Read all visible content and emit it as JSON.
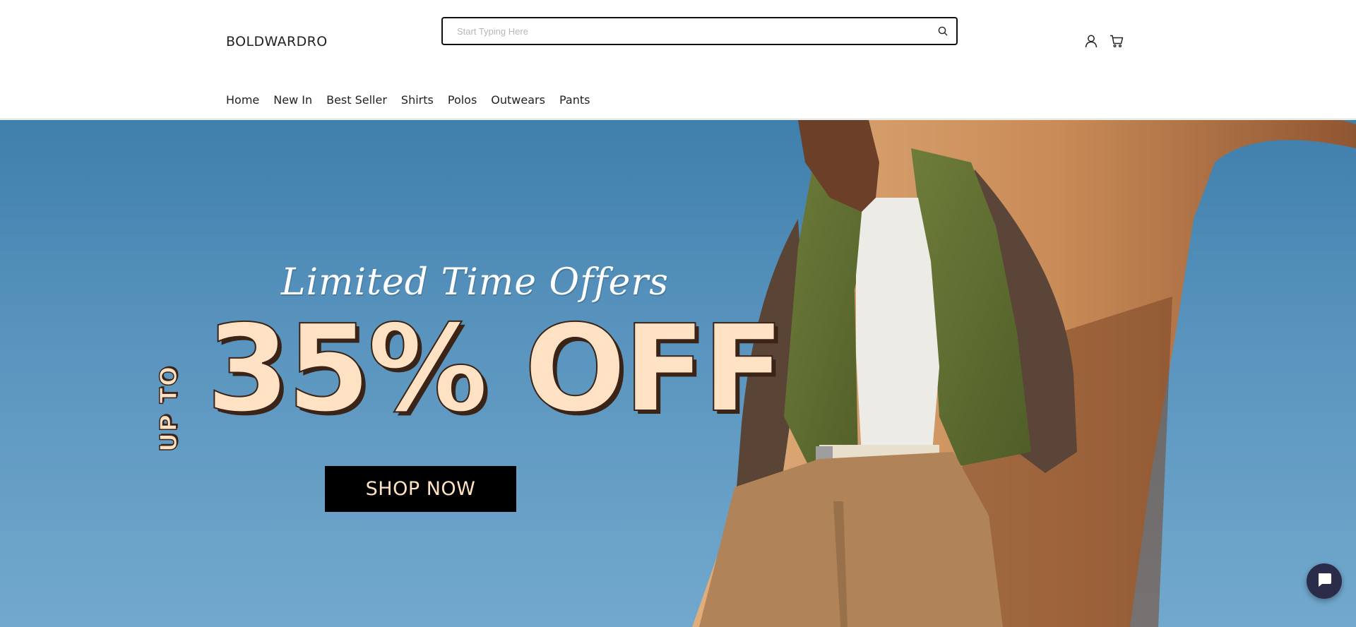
{
  "header": {
    "logo": "BOLDWARDRO",
    "search": {
      "placeholder": "Start Typing Here",
      "value": "",
      "icon": "search-icon"
    },
    "icons": {
      "account": "user-icon",
      "cart": "cart-icon"
    }
  },
  "nav": {
    "items": [
      {
        "label": "Home"
      },
      {
        "label": "New In"
      },
      {
        "label": "Best Seller"
      },
      {
        "label": "Shirts"
      },
      {
        "label": "Polos"
      },
      {
        "label": "Outwears"
      },
      {
        "label": "Pants"
      }
    ]
  },
  "hero": {
    "script_text": "Limited Time Offers",
    "upto_text": "UP TO",
    "offer_text": "35% OFF",
    "cta_label": "SHOP NOW",
    "colors": {
      "sky": "#5a95bf",
      "text_cream": "#ffe2c4",
      "text_outline": "#3a2418",
      "button_bg": "#000000"
    }
  },
  "chat": {
    "icon": "chat-bubble-icon"
  }
}
